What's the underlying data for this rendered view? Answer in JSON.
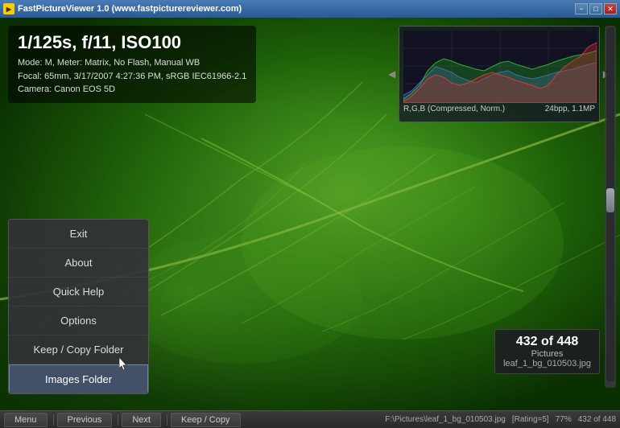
{
  "titlebar": {
    "title": "FastPictureViewer 1.0 (www.fastpicturereviewer.com)",
    "icon": "FPV",
    "minimize_label": "−",
    "maximize_label": "□",
    "close_label": "✕"
  },
  "info_overlay": {
    "title": "1/125s, f/11, ISO100",
    "line1": "Mode: M, Meter: Matrix, No Flash, Manual WB",
    "line2": "Focal: 65mm, 3/17/2007 4:27:36 PM, sRGB IEC61966-2.1",
    "line3": "Camera: Canon EOS 5D"
  },
  "histogram": {
    "label_left": "R,G,B (Compressed, Norm.)",
    "label_right": "24bpp, 1.1MP"
  },
  "dropdown_menu": {
    "items": [
      {
        "label": "Exit",
        "active": false
      },
      {
        "label": "About",
        "active": false
      },
      {
        "label": "Quick Help",
        "active": false
      },
      {
        "label": "Options",
        "active": false
      },
      {
        "label": "Keep / Copy Folder",
        "active": false
      },
      {
        "label": "Images Folder",
        "active": true
      }
    ]
  },
  "image_info": {
    "count": "432 of 448",
    "type": "Pictures",
    "filename": "leaf_1_bg_010503.jpg"
  },
  "bottom_toolbar": {
    "menu_label": "Menu",
    "previous_label": "Previous",
    "next_label": "Next",
    "keep_copy_label": "Keep / Copy",
    "status_path": "F:\\Pictures\\leaf_1_bg_010503.jpg",
    "status_rating": "[Rating=5]",
    "status_zoom": "77%",
    "status_count": "432 of 448"
  }
}
